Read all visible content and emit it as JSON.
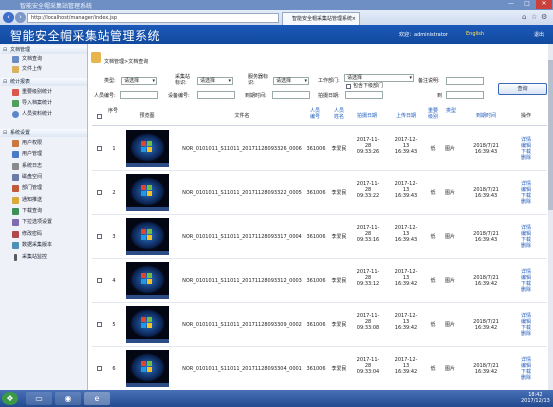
{
  "browser": {
    "window_title": "智能安全帽采集站管理系统",
    "url": "http://localhost/manager/index.jsp",
    "tab_title": "智能安全帽采集站管理系统",
    "min": "—",
    "max": "□",
    "close": "✕"
  },
  "header": {
    "title": "智能安全帽采集站管理系统",
    "welcome": "欢迎：administrator",
    "lang": "English",
    "logout": "退出"
  },
  "sidebar": {
    "sections": [
      {
        "label": "文档管理",
        "items": [
          "文档查询",
          "文件上传"
        ]
      },
      {
        "label": "统计报表",
        "items": [
          "重要级别统计",
          "导入档案统计",
          "人员资料统计"
        ]
      },
      {
        "label": "系统设置",
        "items": [
          "用户权限",
          "用户管理",
          "系统日志",
          "磁盘空间",
          "部门管理",
          "通知推送",
          "下载查询",
          "下拉选项设置",
          "修改密码",
          "数据采集版本",
          "采集站监控"
        ]
      }
    ]
  },
  "breadcrumb": "文档管理>文档查询",
  "filters": {
    "type_label": "类型:",
    "type_value": "请选择",
    "collect_label": "采集站标识:",
    "collect_value": "请选择",
    "server_label": "服务器标识:",
    "server_value": "请选择",
    "dept_label": "工作部门:",
    "dept_value": "请选择",
    "subdept_label": "包含下级部门",
    "note_label": "备注说明:",
    "person_label": "人员编号:",
    "device_label": "设备编号:",
    "arrive_label": "到期时间:",
    "shoot_label": "拍摄日期:",
    "to_label": "到",
    "query_button": "查询"
  },
  "table": {
    "headers": [
      "序号",
      "预览图",
      "文件名",
      "人员编号",
      "人员姓名",
      "拍摄日期",
      "上传日期",
      "重要级别",
      "类型",
      "到期时间",
      "操作"
    ],
    "ops": [
      "详情",
      "编辑",
      "下载",
      "删除"
    ],
    "rows": [
      {
        "no": "1",
        "file": "NOR_0101011_S11011_20171128093326_0006",
        "pid": "361006",
        "name": "李爱民",
        "shot": [
          "2017-11-",
          "28",
          "09:33:26"
        ],
        "upload": [
          "2017-12-",
          "13",
          "16:39:43"
        ],
        "level": "低",
        "type": "图片",
        "expire": [
          "2018/7/21",
          "16:39:43"
        ]
      },
      {
        "no": "2",
        "file": "NOR_0101011_S11011_20171128093322_0005",
        "pid": "361006",
        "name": "李爱民",
        "shot": [
          "2017-11-",
          "28",
          "09:33:22"
        ],
        "upload": [
          "2017-12-",
          "13",
          "16:39:43"
        ],
        "level": "低",
        "type": "图片",
        "expire": [
          "2018/7/21",
          "16:39:43"
        ]
      },
      {
        "no": "3",
        "file": "NOR_0101011_S11011_20171128093317_0004",
        "pid": "361006",
        "name": "李爱民",
        "shot": [
          "2017-11-",
          "28",
          "09:33:16"
        ],
        "upload": [
          "2017-12-",
          "13",
          "16:39:43"
        ],
        "level": "低",
        "type": "图片",
        "expire": [
          "2018/7/21",
          "16:39:43"
        ]
      },
      {
        "no": "4",
        "file": "NOR_0101011_S11011_20171128093312_0003",
        "pid": "361006",
        "name": "李爱民",
        "shot": [
          "2017-11-",
          "28",
          "09:33:12"
        ],
        "upload": [
          "2017-12-",
          "13",
          "16:39:42"
        ],
        "level": "低",
        "type": "图片",
        "expire": [
          "2018/7/21",
          "16:39:42"
        ]
      },
      {
        "no": "5",
        "file": "NOR_0101011_S11011_20171128093309_0002",
        "pid": "361006",
        "name": "李爱民",
        "shot": [
          "2017-11-",
          "28",
          "09:33:08"
        ],
        "upload": [
          "2017-12-",
          "13",
          "16:39:42"
        ],
        "level": "低",
        "type": "图片",
        "expire": [
          "2018/7/21",
          "16:39:42"
        ]
      },
      {
        "no": "6",
        "file": "NOR_0101011_S11011_20171128093304_0001",
        "pid": "361006",
        "name": "李爱民",
        "shot": [
          "2017-11-",
          "28",
          "09:33:04"
        ],
        "upload": [
          "2017-12-",
          "13",
          "16:39:42"
        ],
        "level": "低",
        "type": "图片",
        "expire": [
          "2018/7/21",
          "16:39:42"
        ]
      }
    ]
  },
  "taskbar": {
    "time": "18:42",
    "date": "2017/12/13"
  }
}
